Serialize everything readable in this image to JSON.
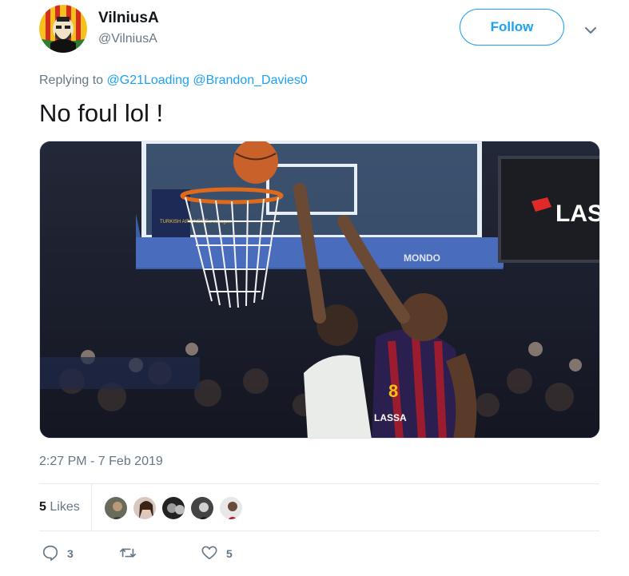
{
  "author": {
    "display_name": "VilniusA",
    "handle": "@VilniusA",
    "avatar_icon": "bearded-man-avatar-icon"
  },
  "follow_label": "Follow",
  "reply": {
    "prefix": "Replying to",
    "mentions": [
      "@G21Loading",
      "@Brandon_Davies0"
    ]
  },
  "tweet_text": "No foul lol !",
  "media": {
    "description_icon": "basketball-dunk-image",
    "jersey_number": "8",
    "sponsor": "LASSA",
    "court_brand": "MONDO",
    "banner_text": "LAS",
    "stanchion_logo": "TURKISH AIRLINES EuroLeague"
  },
  "timestamp": "2:27 PM - 7 Feb 2019",
  "likes": {
    "count": "5",
    "label": "Likes"
  },
  "actions": {
    "reply_count": "3",
    "retweet_count": "",
    "like_count": "5"
  },
  "colors": {
    "accent": "#1da1f2",
    "muted": "#657786"
  }
}
